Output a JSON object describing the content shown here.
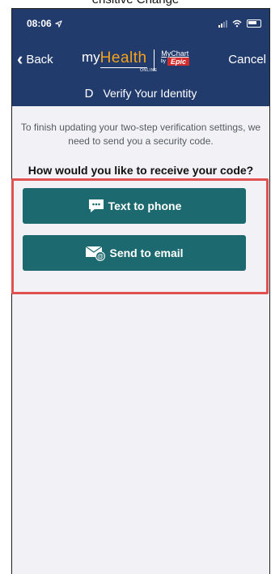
{
  "page_caption": "ensitive Change",
  "status": {
    "time": "08:06"
  },
  "nav": {
    "back_label": "Back",
    "cancel_label": "Cancel",
    "logo": {
      "my": "my",
      "health": "Health",
      "online": "ONLINE",
      "mychart": "MyChart",
      "by": "by",
      "epic": "Epic"
    }
  },
  "title": {
    "letter": "D",
    "text": "Verify Your Identity"
  },
  "content": {
    "intro": "To finish updating your two-step verification settings, we need to send you a security code.",
    "question": "How would you like to receive your code?"
  },
  "options": {
    "text_label": "Text to phone",
    "email_label": "Send to email"
  },
  "colors": {
    "header": "#223b6d",
    "button": "#1c6a6f",
    "logo_accent": "#f7a21b",
    "highlight": "#e05252",
    "epic_red": "#d32c2c",
    "background": "#f2f2f6"
  },
  "icons": {
    "text": "chat-bubble-icon",
    "email": "email-at-icon",
    "location": "location-arrow-icon",
    "back": "chevron-left-icon"
  }
}
